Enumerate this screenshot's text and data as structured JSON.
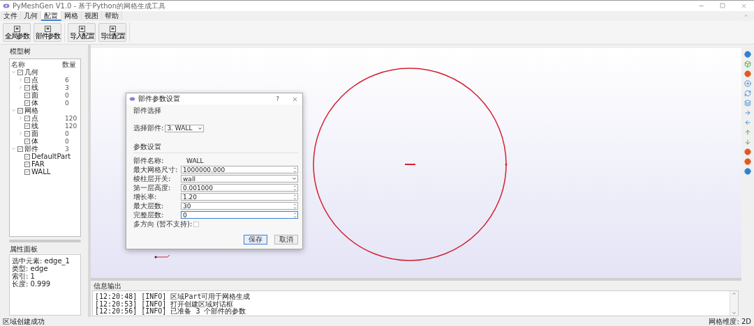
{
  "window": {
    "title": "PyMeshGen V1.0 - 基于Python的网格生成工具"
  },
  "menu_tabs": [
    {
      "label": "文件",
      "selected": false
    },
    {
      "label": "几何",
      "selected": false
    },
    {
      "label": "配置",
      "selected": true
    },
    {
      "label": "网格",
      "selected": false
    },
    {
      "label": "视图",
      "selected": false
    },
    {
      "label": "帮助",
      "selected": false
    }
  ],
  "toolbar": {
    "groups": [
      [
        "全局参数",
        "部件参数"
      ],
      [
        "导入配置",
        "导出配置"
      ]
    ]
  },
  "model_tree": {
    "title": "模型树",
    "columns": [
      "名称",
      "数量"
    ],
    "nodes": [
      {
        "label": "几何",
        "checked": true,
        "expanded": true,
        "children": [
          {
            "label": "点",
            "count": "6",
            "checked": true,
            "expanded": false
          },
          {
            "label": "线",
            "count": "3",
            "checked": true,
            "expanded": false
          },
          {
            "label": "面",
            "count": "0",
            "checked": true
          },
          {
            "label": "体",
            "count": "0",
            "checked": true
          }
        ]
      },
      {
        "label": "网格",
        "checked": true,
        "expanded": true,
        "children": [
          {
            "label": "点",
            "count": "120",
            "checked": true,
            "expanded": false
          },
          {
            "label": "线",
            "count": "120",
            "checked": true
          },
          {
            "label": "面",
            "count": "0",
            "checked": true,
            "expanded": false
          },
          {
            "label": "体",
            "count": "0",
            "checked": true
          }
        ]
      },
      {
        "label": "部件",
        "count": "3",
        "checked": true,
        "expanded": true,
        "children": [
          {
            "label": "DefaultPart",
            "checked": true
          },
          {
            "label": "FAR",
            "checked": true
          },
          {
            "label": "WALL",
            "checked": true
          }
        ]
      }
    ]
  },
  "properties": {
    "title": "属性面板",
    "lines": [
      "选中元素: edge_1",
      "类型: edge",
      "索引: 1",
      "长度: 0.999"
    ]
  },
  "dialog": {
    "title": "部件参数设置",
    "help": "?",
    "section_1": "部件选择",
    "part_label": "选择部件:",
    "part_value": "3. WALL",
    "section_2": "参数设置",
    "fields": [
      {
        "kind": "static",
        "label": "部件名称:",
        "value": "WALL"
      },
      {
        "kind": "spin",
        "label": "最大网格尺寸:",
        "value": "1000000.000",
        "focused": false
      },
      {
        "kind": "combo",
        "label": "棱柱层开关:",
        "value": "wall",
        "focused": false
      },
      {
        "kind": "spin",
        "label": "第一层高度:",
        "value": "0.001000",
        "focused": false
      },
      {
        "kind": "spin",
        "label": "增长率:",
        "value": "1.20",
        "focused": false
      },
      {
        "kind": "spin",
        "label": "最大层数:",
        "value": "30",
        "focused": false
      },
      {
        "kind": "spin",
        "label": "完整层数:",
        "value": "0",
        "focused": true
      },
      {
        "kind": "checkbox",
        "label": "多方向 (暂不支持):",
        "checked": false
      }
    ],
    "buttons": [
      {
        "label": "保存",
        "primary": true
      },
      {
        "label": "取消",
        "primary": false
      }
    ]
  },
  "output": {
    "title": "信息输出",
    "lines": [
      "[12:20:48] [INFO] 区域Part可用于网格生成",
      "[12:20:53] [INFO] 打开创建区域对话框",
      "[12:20:56] [INFO] 已准备 3 个部件的参数"
    ]
  },
  "status_bar": {
    "message": "区域创建成功",
    "mesh_dimension": "网格维度: 2D"
  }
}
